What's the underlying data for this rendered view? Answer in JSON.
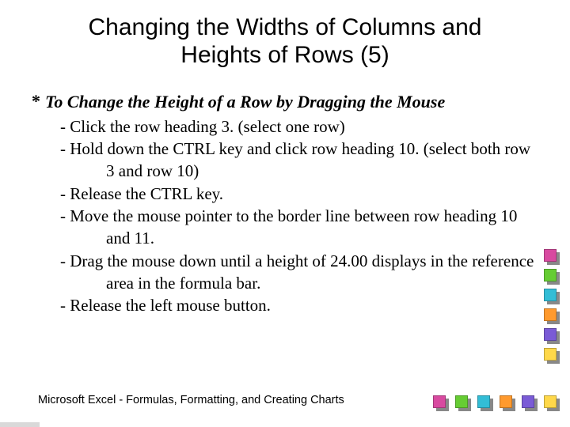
{
  "title_line1": "Changing the Widths of Columns and",
  "title_line2": "Heights of Rows (5)",
  "bullet_marker": "*",
  "section_heading": "To Change the Height of a Row by Dragging the Mouse",
  "steps": [
    "- Click the row heading 3. (select one row)",
    "- Hold down the CTRL key and click row heading 10. (select both row 3 and row 10)",
    "- Release the CTRL key.",
    "- Move the mouse pointer to the border line between row heading 10 and 11.",
    "- Drag the mouse down until a height of 24.00 displays in the reference area in the formula bar.",
    "- Release the left mouse button."
  ],
  "footer": "Microsoft  Excel - Formulas, Formatting, and Creating Charts",
  "deco_colors_right": [
    "#d84aa0",
    "#66cc33",
    "#33bdd6",
    "#ff9a2e",
    "#7a5bd6",
    "#ffd84a"
  ],
  "deco_colors_bottom": [
    "#d84aa0",
    "#66cc33",
    "#33bdd6",
    "#ff9a2e",
    "#7a5bd6",
    "#ffd84a"
  ]
}
